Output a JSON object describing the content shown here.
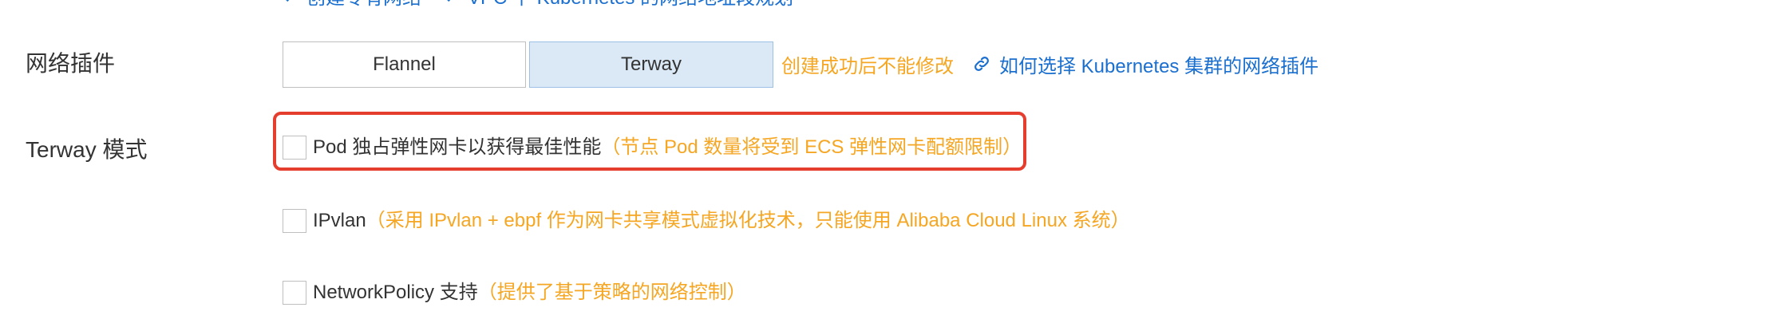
{
  "top_links": [
    {
      "label": "创建专有网络",
      "icon": "check-link-icon"
    },
    {
      "label": "VPC 下 Kubernetes 的网络地址段规划",
      "icon": "check-link-icon"
    }
  ],
  "network_plugin": {
    "label": "网络插件",
    "options": [
      "Flannel",
      "Terway"
    ],
    "selected": "Terway",
    "warning": "创建成功后不能修改",
    "help_link": {
      "label": "如何选择 Kubernetes 集群的网络插件",
      "icon": "link-icon"
    }
  },
  "terway_mode": {
    "label": "Terway 模式",
    "options": [
      {
        "label": "Pod 独占弹性网卡以获得最佳性能",
        "note": "（节点 Pod 数量将受到 ECS 弹性网卡配额限制）",
        "checked": false,
        "highlighted": true
      },
      {
        "label": "IPvlan",
        "note": "（采用 IPvlan + ebpf 作为网卡共享模式虚拟化技术，只能使用 Alibaba Cloud Linux 系统）",
        "checked": false,
        "highlighted": false
      },
      {
        "label": "NetworkPolicy 支持",
        "note": "（提供了基于策略的网络控制）",
        "checked": false,
        "highlighted": false
      }
    ]
  },
  "colors": {
    "link": "#1a6fcf",
    "warning": "#f5a623",
    "highlight_border": "#e53d2e",
    "selected_bg": "#dbe8f5"
  }
}
